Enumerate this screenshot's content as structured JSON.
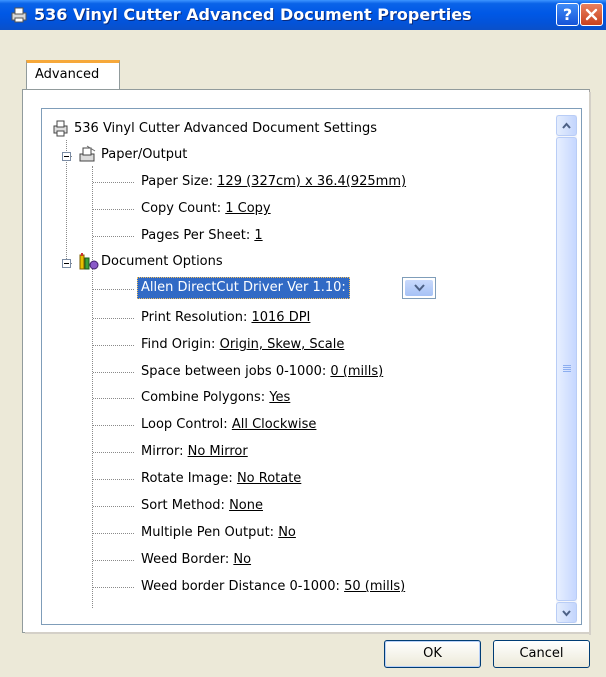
{
  "window": {
    "title": "536 Vinyl Cutter Advanced Document Properties",
    "help_glyph": "?",
    "title_color": "#0058e6"
  },
  "tabs": [
    {
      "label": "Advanced",
      "active": true
    }
  ],
  "tree": {
    "root": {
      "label": "536 Vinyl Cutter Advanced Document Settings",
      "icon": "printer-icon"
    },
    "groups": [
      {
        "label": "Paper/Output",
        "icon": "paper-printer-icon",
        "expanded": true,
        "items": [
          {
            "name": "Paper Size:",
            "value": "129 (327cm) x 36.4(925mm)"
          },
          {
            "name": "Copy Count:",
            "value": "1 Copy"
          },
          {
            "name": "Pages Per Sheet:",
            "value": "1"
          }
        ]
      },
      {
        "label": "Document Options",
        "icon": "document-options-icon",
        "expanded": true,
        "selected": "Allen DirectCut Driver Ver 1.10:",
        "items": [
          {
            "name": "Print Resolution:",
            "value": "1016 DPI"
          },
          {
            "name": "Find Origin:",
            "value": "Origin, Skew,  Scale"
          },
          {
            "name": "Space between jobs 0-1000:",
            "value": "0 (mills)"
          },
          {
            "name": "Combine Polygons:",
            "value": "Yes"
          },
          {
            "name": "Loop Control:",
            "value": "All Clockwise"
          },
          {
            "name": "Mirror:",
            "value": "No Mirror"
          },
          {
            "name": "Rotate Image:",
            "value": "No Rotate"
          },
          {
            "name": "Sort Method:",
            "value": "None"
          },
          {
            "name": "Multiple Pen Output:",
            "value": "No"
          },
          {
            "name": "Weed Border:",
            "value": "No"
          },
          {
            "name": "Weed border Distance 0-1000:",
            "value": "50 (mills)"
          }
        ]
      }
    ]
  },
  "buttons": {
    "ok": "OK",
    "cancel": "Cancel"
  },
  "colors": {
    "selection": "#316ac5",
    "dialog_bg": "#ECE9D8",
    "tab_accent": "#f6a83a"
  }
}
